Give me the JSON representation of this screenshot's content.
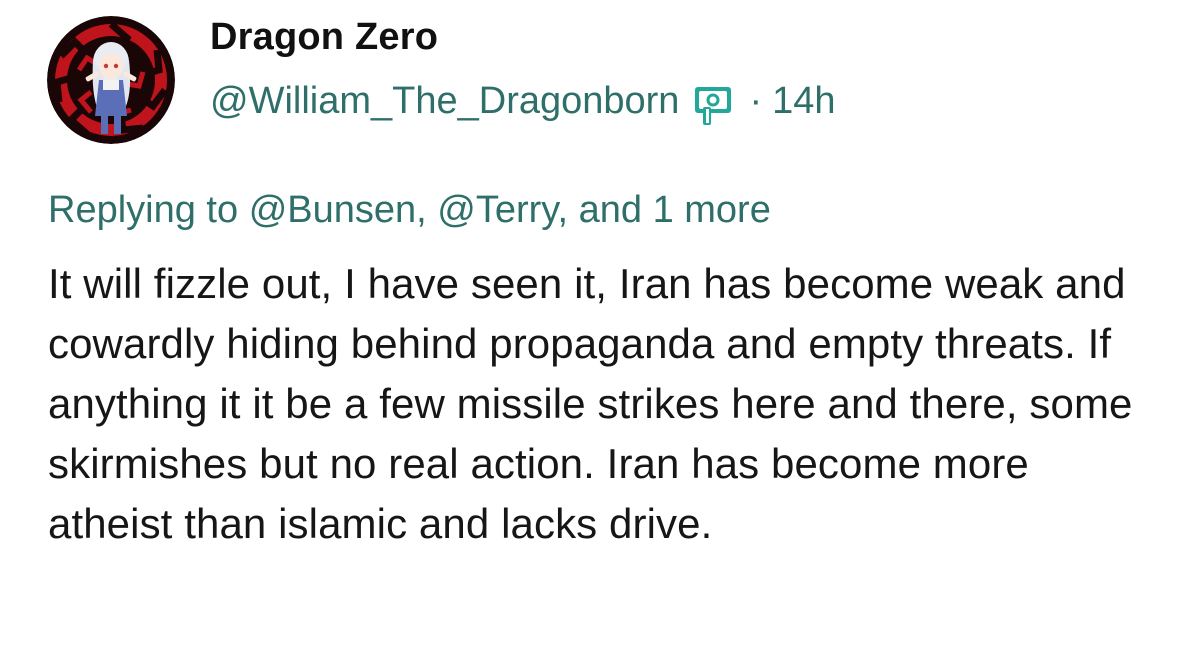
{
  "post": {
    "author": {
      "display_name": "Dragon Zero",
      "handle": "@William_The_Dragonborn",
      "badge_icon": "pleroma-badge-icon",
      "avatar_icon": "anime-avatar-icon"
    },
    "timestamp_separator": "·",
    "timestamp": "14h",
    "reply": {
      "prefix": "Replying to",
      "mentions": [
        "@Bunsen",
        "@Terry"
      ],
      "sep1": ",",
      "sep2": ", and",
      "more": "1 more"
    },
    "text": "It will fizzle out, I have seen it, Iran has become weak and cowardly hiding behind propaganda and empty threats. If anything it it be a few missile strikes here and there, some skirmishes but no real action. Iran has become more atheist than islamic and lacks drive."
  },
  "colors": {
    "accent": "#2f6f6a",
    "text": "#161616",
    "name": "#111111",
    "avatar_bg": "#c0141c",
    "avatar_dark": "#1a0606",
    "badge_teal": "#21a89a"
  }
}
